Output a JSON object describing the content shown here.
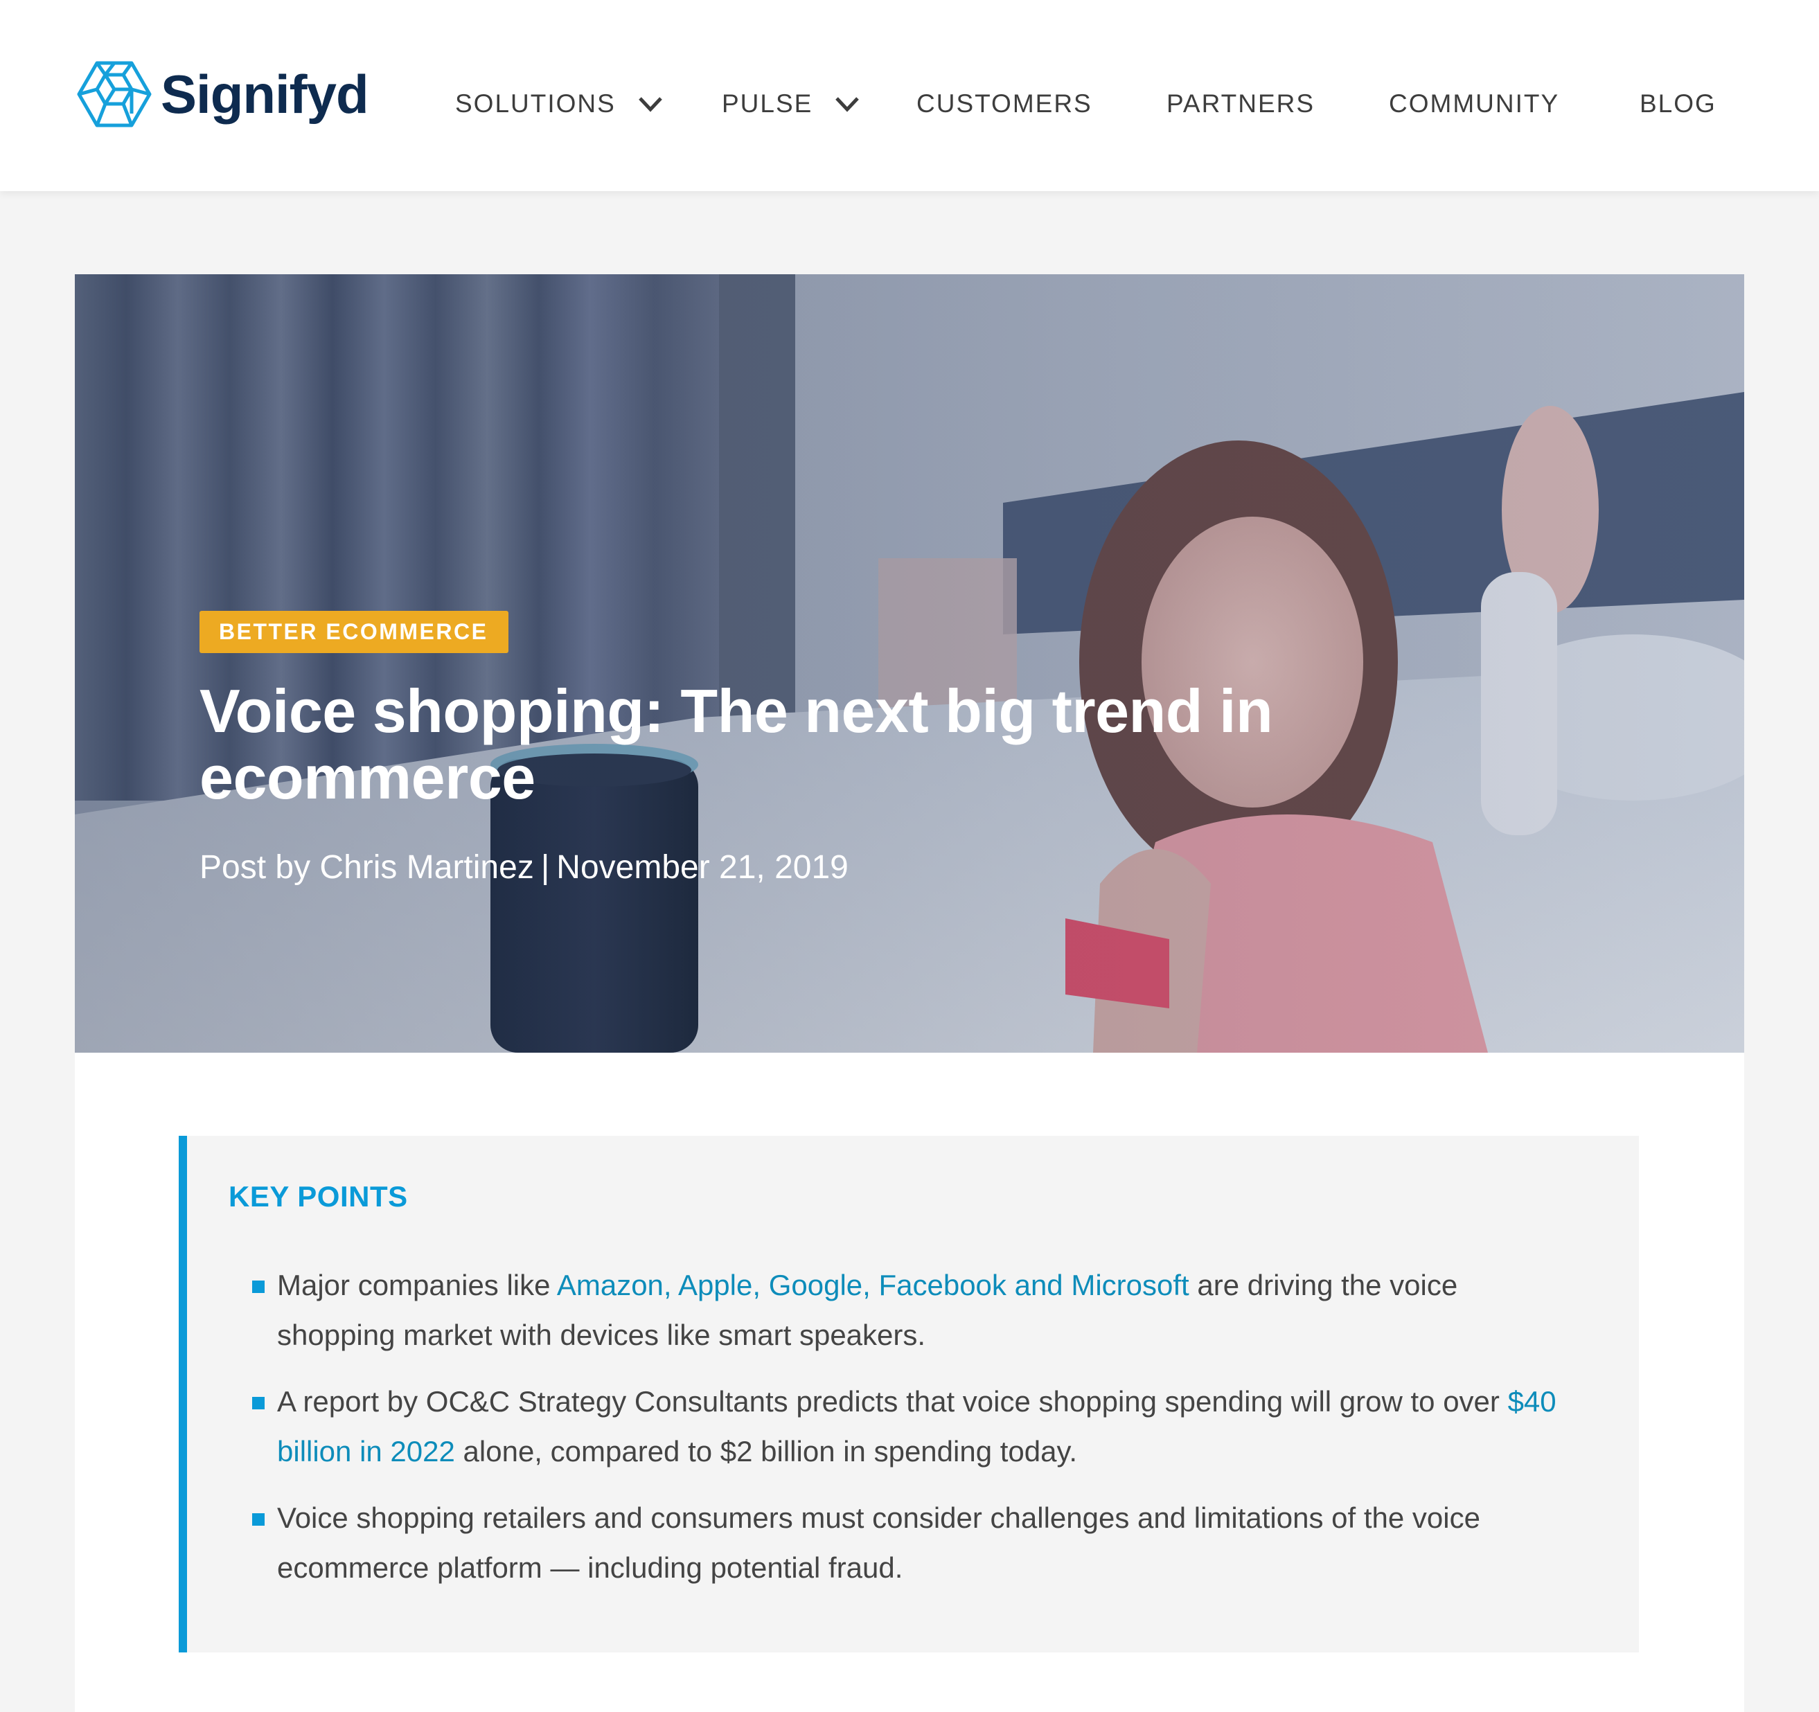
{
  "brand": {
    "name": "Signifyd",
    "logo_icon": "hexagon-cube-logo-icon",
    "colors": {
      "logo_blue": "#16a0db",
      "logo_navy": "#0e2b4f",
      "accent_blue": "#0a9ad8",
      "link_blue": "#0d8cba",
      "badge_orange": "#edaa22"
    }
  },
  "nav": {
    "items": [
      {
        "label": "SOLUTIONS",
        "has_dropdown": true,
        "icon": "chevron-down-icon"
      },
      {
        "label": "PULSE",
        "has_dropdown": true,
        "icon": "chevron-down-icon"
      },
      {
        "label": "CUSTOMERS",
        "has_dropdown": false
      },
      {
        "label": "PARTNERS",
        "has_dropdown": false
      },
      {
        "label": "COMMUNITY",
        "has_dropdown": false
      },
      {
        "label": "BLOG",
        "has_dropdown": false
      }
    ]
  },
  "hero": {
    "category": "BETTER ECOMMERCE",
    "title": "Voice shopping: The next big trend in ecommerce",
    "byline_prefix": "Post by Chris Martinez",
    "byline_separator": "|",
    "date": "November 21, 2019",
    "image_description": "woman lying on bed smiling at phone next to smart speaker"
  },
  "key_points": {
    "heading": "KEY POINTS",
    "items": [
      {
        "before": "Major companies like ",
        "link": "Amazon, Apple, Google, Facebook and Microsoft",
        "after": " are driving the voice shopping market with devices like smart speakers."
      },
      {
        "before": "A report by OC&C Strategy Consultants predicts that voice shopping spending will grow to over ",
        "link": "$40 billion in 2022",
        "after": " alone, compared to $2 billion in spending today."
      },
      {
        "before": "Voice shopping retailers and consumers must consider challenges and limitations of the voice ecommerce platform — including potential fraud.",
        "link": null,
        "after": ""
      }
    ]
  }
}
